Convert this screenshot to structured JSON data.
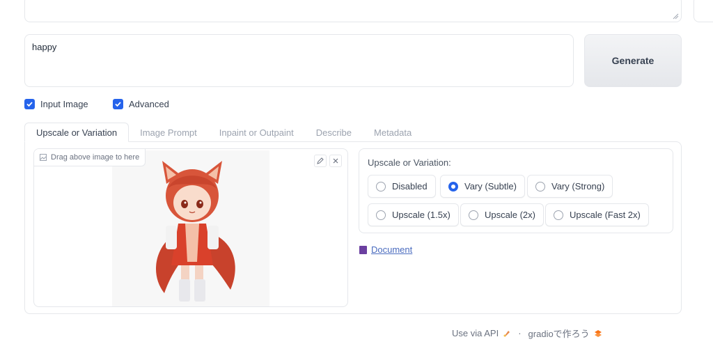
{
  "prompt": {
    "value": "happy"
  },
  "generate": {
    "label": "Generate"
  },
  "checkboxes": [
    {
      "label": "Input Image",
      "checked": true
    },
    {
      "label": "Advanced",
      "checked": true
    }
  ],
  "tabs": [
    {
      "label": "Upscale or Variation",
      "active": true
    },
    {
      "label": "Image Prompt",
      "active": false
    },
    {
      "label": "Inpaint or Outpaint",
      "active": false
    },
    {
      "label": "Describe",
      "active": false
    },
    {
      "label": "Metadata",
      "active": false
    }
  ],
  "image_panel": {
    "label": "Drag above image to here",
    "edit_icon": "pencil-icon",
    "clear_icon": "close-icon",
    "image_subject": "chibi fox-girl in red dress"
  },
  "variation": {
    "label": "Upscale or Variation:",
    "options": [
      {
        "label": "Disabled",
        "selected": false
      },
      {
        "label": "Vary (Subtle)",
        "selected": true
      },
      {
        "label": "Vary (Strong)",
        "selected": false
      },
      {
        "label": "Upscale (1.5x)",
        "selected": false
      },
      {
        "label": "Upscale (2x)",
        "selected": false
      },
      {
        "label": "Upscale (Fast 2x)",
        "selected": false
      }
    ]
  },
  "document_link": {
    "label": "Document"
  },
  "footer": {
    "api": "Use via API",
    "separator": "·",
    "built_with": "gradioで作ろう"
  },
  "colors": {
    "accent": "#2563eb",
    "border": "#e5e7eb",
    "link": "#4b6cbf"
  }
}
